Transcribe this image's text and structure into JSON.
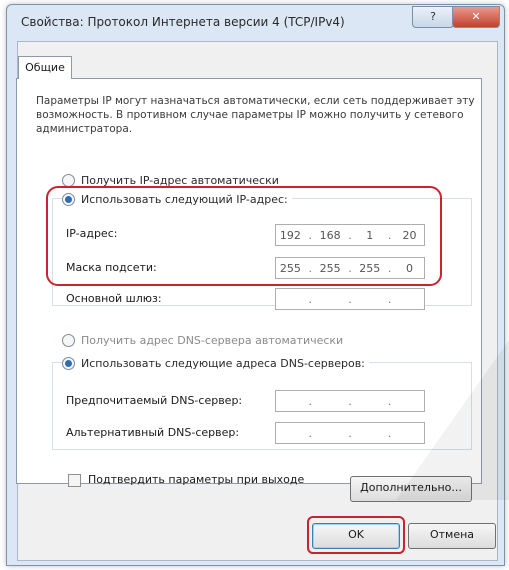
{
  "window": {
    "title": "Свойства: Протокол Интернета версии 4 (TCP/IPv4)",
    "help_label": "?",
    "close_label": "✕"
  },
  "tabs": [
    {
      "label": "Общие"
    }
  ],
  "description": "Параметры IP могут назначаться автоматически, если сеть поддерживает эту возможность. В противном случае параметры IP можно получить у сетевого администратора.",
  "ip_section": {
    "auto_label": "Получить IP-адрес автоматически",
    "manual_label": "Использовать следующий IP-адрес:",
    "selected": "manual",
    "fields": [
      {
        "label": "IP-адрес:",
        "value": [
          "192",
          "168",
          "1",
          "20"
        ]
      },
      {
        "label": "Маска подсети:",
        "value": [
          "255",
          "255",
          "255",
          "0"
        ]
      },
      {
        "label": "Основной шлюз:",
        "value": [
          "",
          "",
          "",
          ""
        ]
      }
    ]
  },
  "dns_section": {
    "auto_label": "Получить адрес DNS-сервера автоматически",
    "manual_label": "Использовать следующие адреса DNS-серверов:",
    "selected": "manual",
    "fields": [
      {
        "label": "Предпочитаемый DNS-сервер:",
        "value": [
          "",
          "",
          "",
          ""
        ]
      },
      {
        "label": "Альтернативный DNS-сервер:",
        "value": [
          "",
          "",
          "",
          ""
        ]
      }
    ]
  },
  "validate_label": "Подтвердить параметры при выходе",
  "buttons": {
    "advanced": "Дополнительно...",
    "ok": "OK",
    "cancel": "Отмена"
  },
  "colors": {
    "highlight": "#c8232e",
    "accent": "#2e6bb3"
  }
}
